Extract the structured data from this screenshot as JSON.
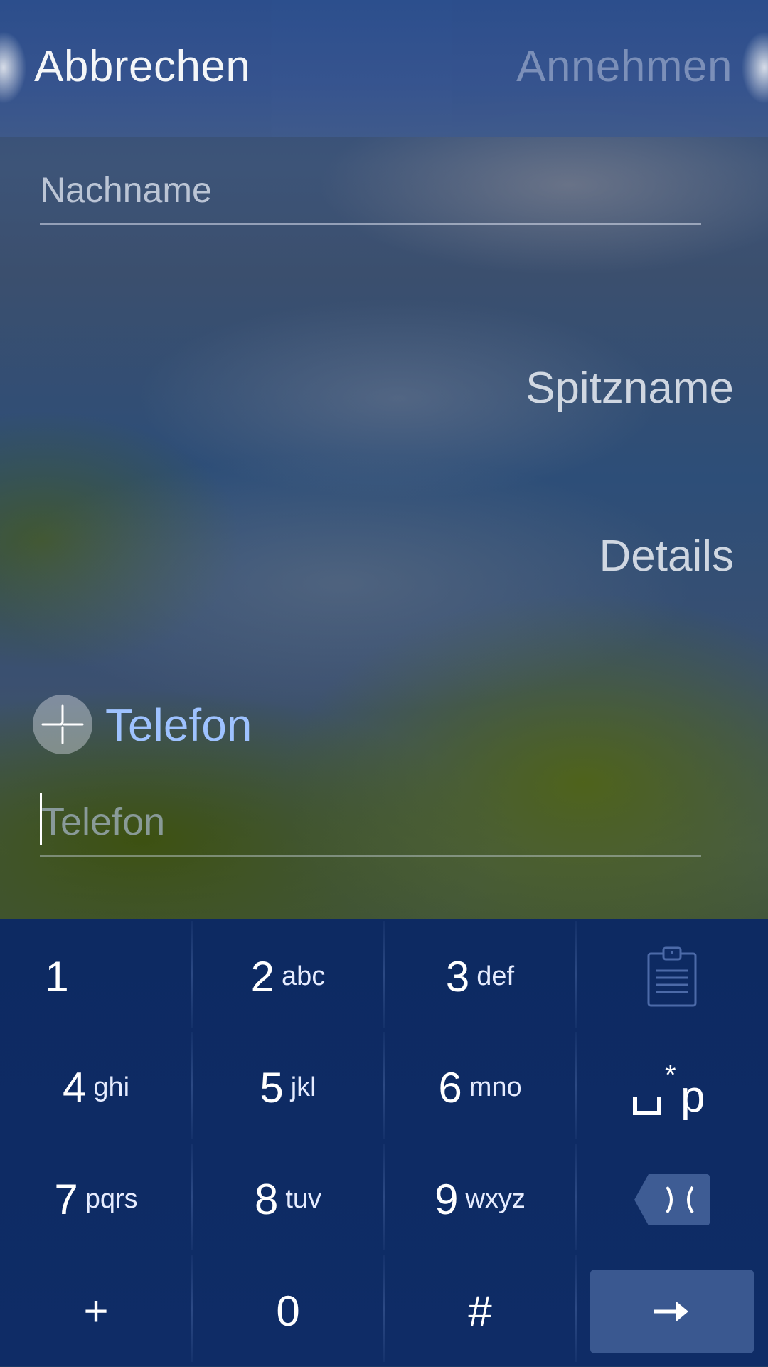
{
  "header": {
    "cancel_label": "Abbrechen",
    "accept_label": "Annehmen"
  },
  "form": {
    "lastname_placeholder": "Nachname",
    "nickname_label": "Spitzname",
    "details_label": "Details",
    "phone_section_title": "Telefon",
    "phone_placeholder": "Telefon"
  },
  "keypad": {
    "keys": [
      {
        "num": "1",
        "letters": ""
      },
      {
        "num": "2",
        "letters": "abc"
      },
      {
        "num": "3",
        "letters": "def"
      },
      {
        "num": "4",
        "letters": "ghi"
      },
      {
        "num": "5",
        "letters": "jkl"
      },
      {
        "num": "6",
        "letters": "mno"
      },
      {
        "num": "7",
        "letters": "pqrs"
      },
      {
        "num": "8",
        "letters": "tuv"
      },
      {
        "num": "9",
        "letters": "wxyz"
      },
      {
        "num": "+",
        "letters": ""
      },
      {
        "num": "0",
        "letters": ""
      },
      {
        "num": "#",
        "letters": ""
      }
    ],
    "special_icons": [
      "clipboard-icon",
      "pause-wait-icon",
      "backspace-icon",
      "enter-icon"
    ]
  },
  "colors": {
    "accent": "#9ec2ff",
    "keyboard_bg": "#0f2c66"
  }
}
